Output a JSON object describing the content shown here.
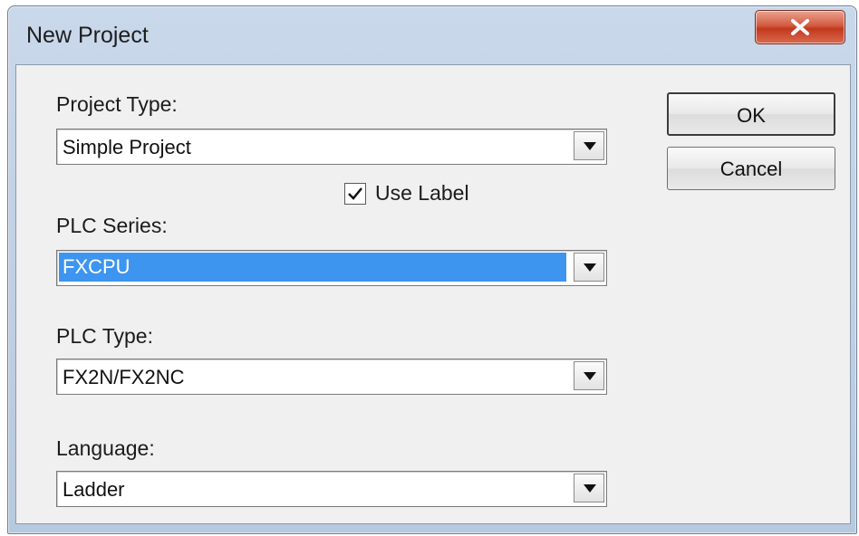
{
  "dialog": {
    "title": "New Project",
    "close_glyph": "×"
  },
  "buttons": {
    "ok": "OK",
    "cancel": "Cancel"
  },
  "project_type": {
    "label": "Project Type:",
    "value": "Simple Project"
  },
  "use_label": {
    "label": "Use Label",
    "checked": true
  },
  "plc_series": {
    "label": "PLC Series:",
    "value": "FXCPU"
  },
  "plc_type": {
    "label": "PLC Type:",
    "value": "FX2N/FX2NC"
  },
  "language": {
    "label": "Language:",
    "value": "Ladder"
  },
  "icons": {
    "close": "close-icon",
    "dropdown": "chevron-down-icon",
    "check": "checkmark-icon"
  },
  "colors": {
    "selection": "#3d95f0",
    "close_button": "#c2391d",
    "title_bar": "#c9d8ea"
  }
}
